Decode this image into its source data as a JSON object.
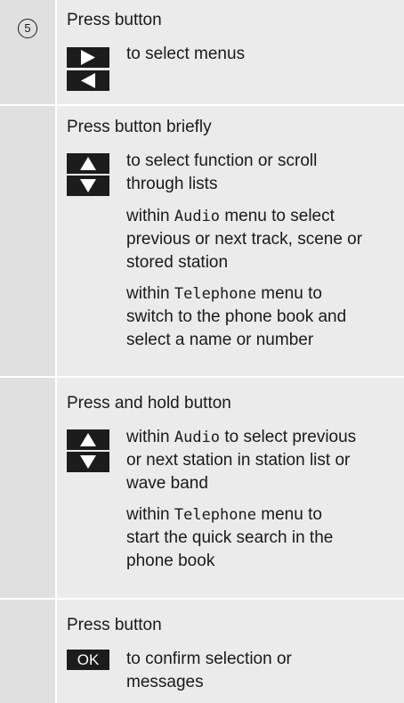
{
  "step_number": "5",
  "sections": [
    {
      "heading": "Press button",
      "keys": [
        "right-arrow-key",
        "left-arrow-key"
      ],
      "text": "to select menus"
    },
    {
      "heading": "Press button briefly",
      "keys": [
        "up-arrow-key",
        "down-arrow-key"
      ],
      "text_line1": "to select function or scroll",
      "text_line2": "through lists",
      "audio": {
        "prefix": "within ",
        "code": "Audio",
        "line1_rest": " menu to select",
        "line2": "previous or next track, scene or",
        "line3": "stored station"
      },
      "telephone": {
        "prefix": "within ",
        "code": "Telephone",
        "line1_rest": " menu to",
        "line2": "switch to the phone book and",
        "line3": "select a name or number"
      }
    },
    {
      "heading": "Press and hold button",
      "keys": [
        "up-arrow-key",
        "down-arrow-key"
      ],
      "audio": {
        "prefix": "within ",
        "code": "Audio",
        "line1_rest": " to select previous",
        "line2": "or next station in station list or",
        "line3": "wave band"
      },
      "telephone": {
        "prefix": "within ",
        "code": "Telephone",
        "line1_rest": " menu to",
        "line2": "start the quick search in the",
        "line3": "phone book"
      }
    },
    {
      "heading": "Press button",
      "key_label": "OK",
      "text_line1": "to confirm selection or",
      "text_line2": "messages"
    }
  ]
}
